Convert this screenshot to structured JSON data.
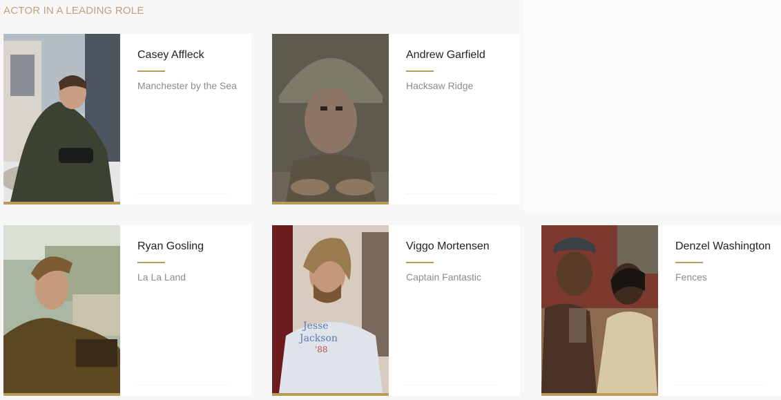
{
  "category": {
    "title": "ACTOR IN A LEADING ROLE"
  },
  "nominees": [
    {
      "name": "Casey Affleck",
      "film": "Manchester by the Sea"
    },
    {
      "name": "Andrew Garfield",
      "film": "Hacksaw Ridge"
    },
    {
      "name": "Ryan Gosling",
      "film": "La La Land"
    },
    {
      "name": "Viggo Mortensen",
      "film": "Captain Fantastic"
    },
    {
      "name": "Denzel Washington",
      "film": "Fences"
    }
  ],
  "colors": {
    "accent_gold": "#b89b57",
    "title_gold": "#b8a47c",
    "page_bg": "#f7f7f7",
    "card_bg": "#ffffff"
  }
}
